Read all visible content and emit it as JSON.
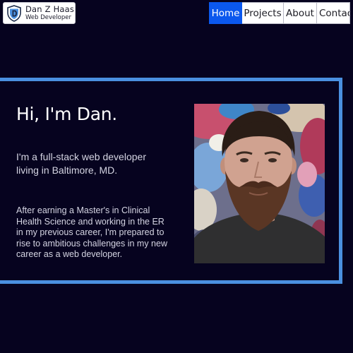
{
  "header": {
    "logo": {
      "name": "Dan Z Haas",
      "role": "Web Developer",
      "icon": "shield-d-icon"
    },
    "nav": [
      {
        "label": "Home",
        "active": true
      },
      {
        "label": "Projects",
        "active": false
      },
      {
        "label": "About",
        "active": false
      },
      {
        "label": "Contact",
        "active": false
      }
    ]
  },
  "hero": {
    "title": "Hi, I'm Dan.",
    "intro": "I'm a full-stack web developer living in Baltimore, MD.",
    "bio": "After earning a Master's in Clinical Health Science and working in the ER in my previous career, I'm prepared to rise to ambitious challenges in my new career as a web developer.",
    "photo": "portrait-photo"
  },
  "colors": {
    "background": "#06031f",
    "accent_border": "#4a90e0",
    "nav_active": "#0b58ee",
    "text": "#d4d4e2"
  }
}
